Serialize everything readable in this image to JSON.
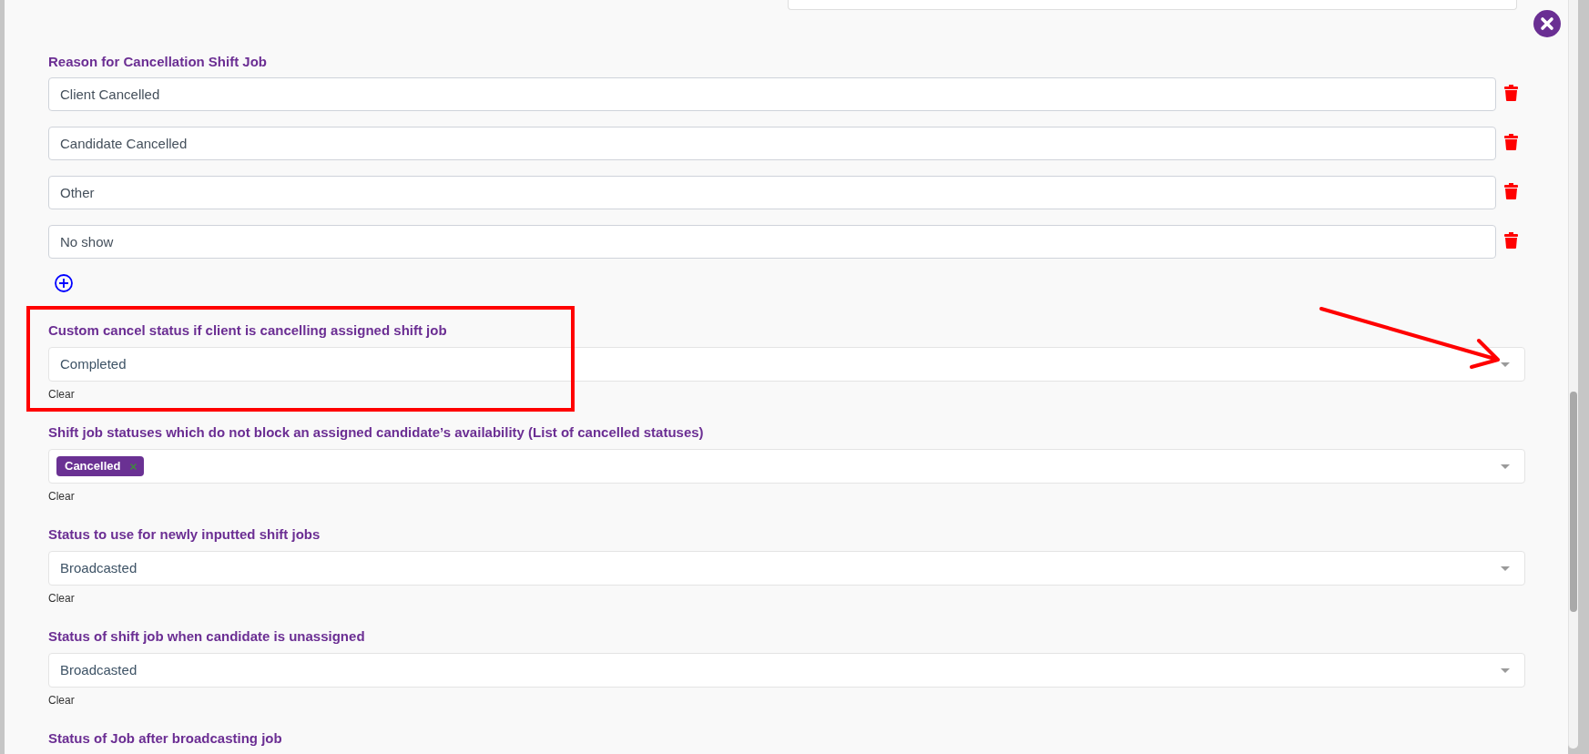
{
  "reasons": {
    "label": "Reason for Cancellation Shift Job",
    "items": [
      "Client Cancelled",
      "Candidate Cancelled",
      "Other",
      "No show"
    ]
  },
  "settings": [
    {
      "kind": "select",
      "label": "Custom cancel status if client is cancelling assigned shift job",
      "value": "Completed",
      "clear": "Clear",
      "highlighted": true
    },
    {
      "kind": "multiselect",
      "label": "Shift job statuses which do not block an assigned candidate’s availability (List of cancelled statuses)",
      "tags": [
        "Cancelled"
      ],
      "clear": "Clear",
      "highlighted": false
    },
    {
      "kind": "select",
      "label": "Status to use for newly inputted shift jobs",
      "value": "Broadcasted",
      "clear": "Clear",
      "highlighted": false
    },
    {
      "kind": "select",
      "label": "Status of shift job when candidate is unassigned",
      "value": "Broadcasted",
      "clear": "Clear",
      "highlighted": false
    },
    {
      "kind": "heading",
      "label": "Status of Job after broadcasting job",
      "highlighted": false
    }
  ]
}
